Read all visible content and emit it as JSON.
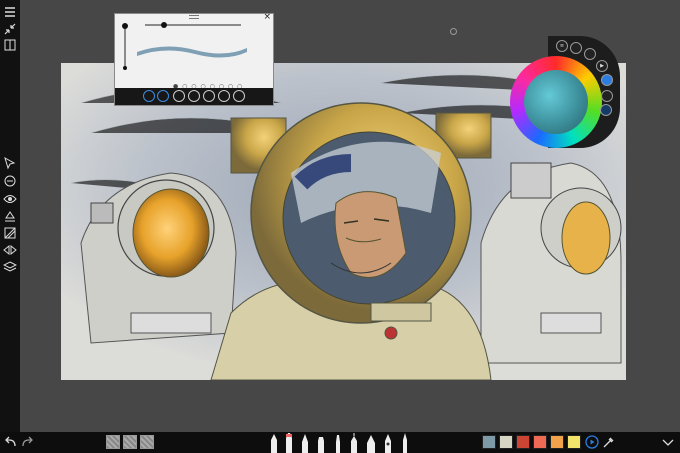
{
  "left_toolbar": {
    "icons": [
      "menu-icon",
      "collapse-icon",
      "gallery-icon",
      "selection-icon",
      "transform-icon",
      "visibility-icon",
      "fill-icon",
      "perspective-icon",
      "symmetry-icon",
      "layers-icon"
    ]
  },
  "brush_panel": {
    "close_symbol": "×",
    "preset_dots": "● ○ ○ ○ ○ ○ ○ ○"
  },
  "color_wheel": {
    "current_color": "#4fb3c1",
    "buttons": [
      "color-picker-menu",
      "swatch-mode",
      "hsl-mode",
      "play-icon",
      "blend-icon",
      "fill-icon"
    ]
  },
  "bottom_toolbar": {
    "textures": [
      "texture-1",
      "texture-2",
      "texture-3"
    ],
    "tools": [
      "pencil",
      "marker",
      "pen",
      "felt-pen",
      "brush",
      "ink-pen",
      "nib",
      "airbrush",
      "smudge"
    ],
    "swatches": [
      "#7d9aa6",
      "#d7d6c5",
      "#cc4433",
      "#ee6a55",
      "#f2a24a",
      "#f2e46a"
    ]
  },
  "canvas": {
    "background": "#d8d8d5"
  }
}
